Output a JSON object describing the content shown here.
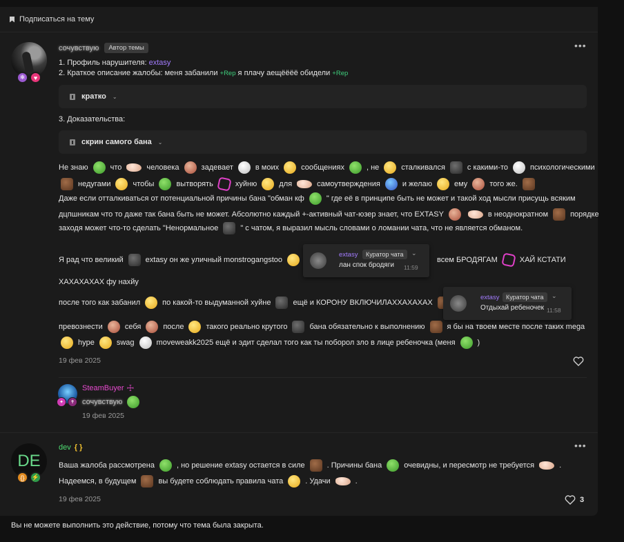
{
  "topic": {
    "subscribe_label": "Подписаться на тему"
  },
  "post1": {
    "username": "сочувствую",
    "role": "Автор темы",
    "line1_prefix": "1. Профиль нарушителя: ",
    "line1_link": "extasy",
    "line2_prefix": "2. Краткое описание жалобы: меня забанили ",
    "rep_tag": "+Rep",
    "line2_mid": " я плачу аещёёёё обидели ",
    "spoiler1": "кратко",
    "line3": "3. Доказательства:",
    "spoiler2": "скрин самого бана",
    "body": [
      [
        "Не знаю",
        "что",
        "человека",
        "задевает",
        "в моих",
        "сообщениях",
        ", не",
        "сталкивался",
        "с какими-то",
        "психологическими"
      ],
      [
        "недугами",
        "чтобы",
        "вытворять",
        "хуйню",
        "для",
        "самоутверждения",
        "и желаю",
        "ему",
        "того же."
      ],
      [
        "Даже если отталкиваться от потенциальной причины бана \"обман кф",
        "\" где её в принципе быть не может и такой ход мысли присущь всяким"
      ],
      [
        "дцпшникам что то даже так бана быть не может. Абсолютно каждый +-активный чат-юзер знает, что EXTASY",
        "в неоднократном",
        "порядке"
      ],
      [
        "заходя может что-то сделать \"Ненормальное",
        "\" с чатом, я выразил мысль словами о ломании чата, что не является обманом."
      ],
      [
        "Я рад что великий",
        "extasy он же уличный monstrogangstoo",
        "всем БРОДЯГАМ",
        "ХАЙ КСТАТИ"
      ],
      [
        "ХАХАХАХАХ фу нахйу"
      ],
      [
        "после того как забанил",
        "по какой-то выдуманной хуйне",
        "ещё и КОРОНУ ВКЛЮЧИЛАХХАХАХАХ"
      ],
      [
        "превознести",
        "себя",
        "после",
        "такого реально крутого",
        "бана обязательно к выполнению",
        "я бы на твоем месте после таких mega"
      ],
      [
        "hype",
        "swag",
        "moveweakk2025 ещё и эдит сделал того как ты поборол зло в лице ребеночка (меня",
        ")"
      ]
    ],
    "date": "19 фев 2025"
  },
  "popups": [
    {
      "name": "extasy",
      "tag": "Куратор чата",
      "text": "лан спок бродяги",
      "time": "11:59"
    },
    {
      "name": "extasy",
      "tag": "Куратор чата",
      "text": "Отдыхай ребеночек",
      "time": "11:58"
    }
  ],
  "reply": {
    "username": "SteamBuyer",
    "quote": "сочувствую",
    "date": "19 фев 2025"
  },
  "post2": {
    "avatar_letters": "DE",
    "username": "dev",
    "brackets": "{ }",
    "line1": [
      "Ваша жалоба рассмотрена",
      ", но решение extasy остается в силе",
      ". Причины бана",
      "очевидны, и пересмотр не требуется",
      "."
    ],
    "line2": [
      "Надеемся, в будущем",
      "вы будете соблюдать правила чата",
      ". Удачи",
      "."
    ],
    "date": "19 фев 2025",
    "likes": "3"
  },
  "closed_notice": "Вы не можете выполнить это действие, потому что тема была закрыта.",
  "colors": {
    "accent_violet": "#a37cff",
    "rep_green": "#3fd07d",
    "dev_green": "#4fdc72",
    "steam_pink": "#e84ad0"
  }
}
